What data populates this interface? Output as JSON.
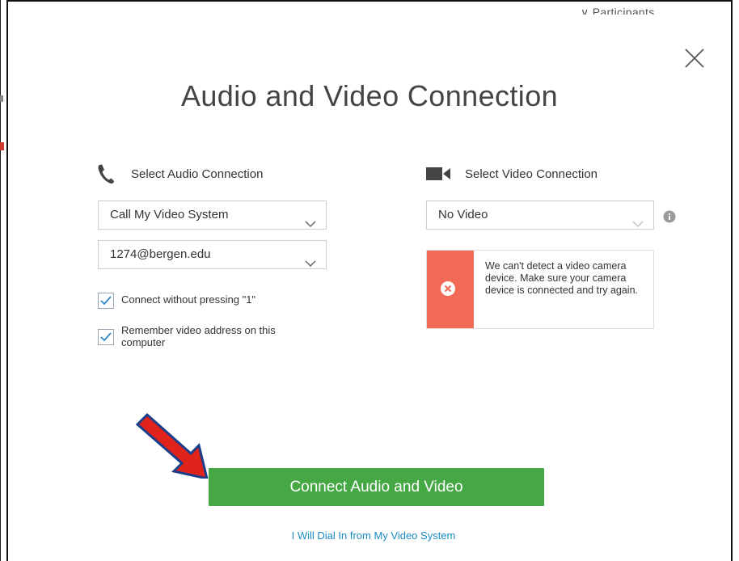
{
  "window": {
    "participants_label": "Participants"
  },
  "dialog": {
    "title": "Audio and Video Connection",
    "close_icon": "close-icon"
  },
  "audio": {
    "heading": "Select Audio Connection",
    "icon": "phone-icon",
    "connection_type": "Call My Video System",
    "video_address": "1274@bergen.edu",
    "options": [
      {
        "label": "Connect without pressing \"1\"",
        "checked": true
      },
      {
        "label": "Remember video address on this computer",
        "checked": true
      }
    ]
  },
  "video": {
    "heading": "Select Video Connection",
    "icon": "camera-icon",
    "connection_type": "No Video",
    "info_icon": "info-icon",
    "alert": {
      "icon": "error-x-icon",
      "message": "We can't detect a video camera device. Make sure your camera device is connected and try again."
    }
  },
  "actions": {
    "connect_label": "Connect Audio and Video",
    "dial_in_label": "I Will Dial In from My Video System"
  },
  "annotation": {
    "icon": "red-arrow-icon",
    "color": "#e0241b"
  },
  "colors": {
    "primary": "#45a845",
    "link": "#1a8bc4",
    "alert": "#f06a55"
  }
}
